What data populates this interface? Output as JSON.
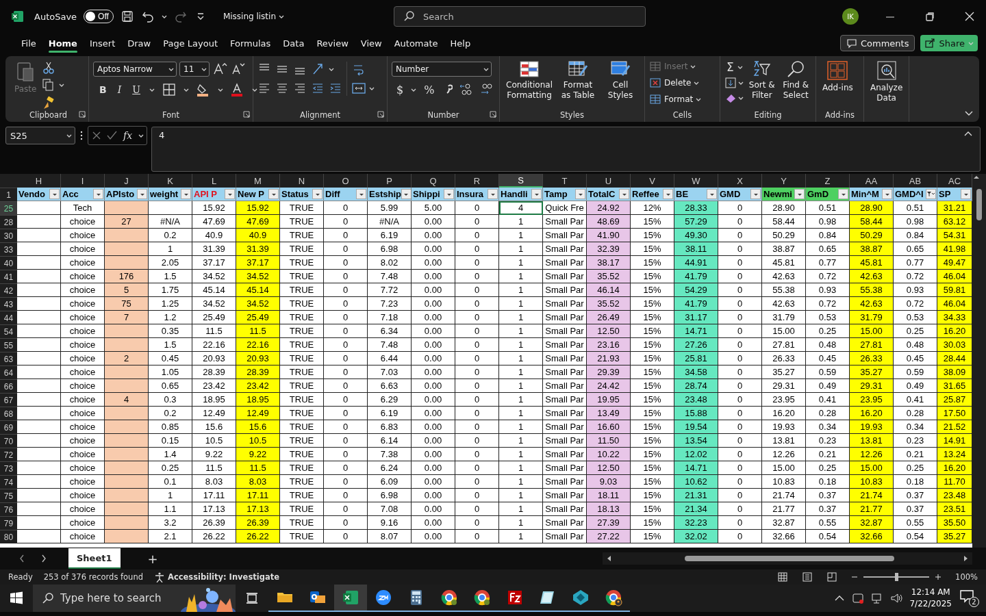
{
  "title_bar": {
    "autosave_label": "AutoSave",
    "autosave": {
      "on": false,
      "label": "Off"
    },
    "file_name": "Missing listin",
    "search": {
      "placeholder": "Search"
    },
    "avatar": "IK"
  },
  "menu_tabs": [
    {
      "label": "File",
      "selected": false
    },
    {
      "label": "Home",
      "selected": true
    },
    {
      "label": "Insert",
      "selected": false
    },
    {
      "label": "Draw",
      "selected": false
    },
    {
      "label": "Page Layout",
      "selected": false
    },
    {
      "label": "Formulas",
      "selected": false
    },
    {
      "label": "Data",
      "selected": false
    },
    {
      "label": "Review",
      "selected": false
    },
    {
      "label": "View",
      "selected": false
    },
    {
      "label": "Automate",
      "selected": false
    },
    {
      "label": "Help",
      "selected": false
    }
  ],
  "comments": "Comments",
  "share": "Share",
  "ribbon": {
    "clipboard": {
      "label": "Clipboard",
      "paste": {
        "label": "Paste",
        "disabled": true
      }
    },
    "font": {
      "label": "Font",
      "font_name": "Aptos Narrow",
      "font_size": "11",
      "bold": "B",
      "italic": "I",
      "underline": "U"
    },
    "alignment": {
      "label": "Alignment"
    },
    "number": {
      "label": "Number",
      "format": "Number",
      "currency": "$",
      "percent": "%"
    },
    "styles": {
      "label": "Styles",
      "buttons": [
        "Conditional Formatting",
        "Format as Table",
        "Cell Styles"
      ]
    },
    "cells": {
      "label": "Cells",
      "buttons": [
        {
          "label": "Insert",
          "disabled": true
        },
        {
          "label": "Delete",
          "disabled": false
        },
        {
          "label": "Format",
          "disabled": false
        }
      ]
    },
    "editing": {
      "label": "Editing",
      "sum": "Σ",
      "buttons": [
        "Sort & Filter",
        "Find & Select"
      ]
    },
    "addins": {
      "label": "Add-ins",
      "button": "Add-ins"
    },
    "analyze": {
      "button": "Analyze Data"
    }
  },
  "formula_bar": {
    "name_box": "S25",
    "fx": "fx",
    "value": "4"
  },
  "sheet": {
    "columns": [
      {
        "letter": "H",
        "header": {
          "label": "Vendo",
          "color": "#9bd3f0",
          "emphasis": false
        },
        "filtered": false,
        "selected": false
      },
      {
        "letter": "I",
        "header": {
          "label": "Acc",
          "color": "#9bd3f0",
          "emphasis": false
        },
        "filtered": false,
        "selected": false
      },
      {
        "letter": "J",
        "header": {
          "label": "APIsto",
          "color": "#9bd3f0",
          "emphasis": false
        },
        "color": "#f8cbad",
        "filtered": false,
        "selected": false
      },
      {
        "letter": "K",
        "header": {
          "label": "weight",
          "color": "#9bd3f0",
          "emphasis": false
        },
        "filtered": false,
        "selected": false
      },
      {
        "letter": "L",
        "header": {
          "label": "API P",
          "color": "#9bd3f0",
          "emphasis": true
        },
        "filtered": false,
        "selected": false
      },
      {
        "letter": "M",
        "header": {
          "label": "New P",
          "color": "#9bd3f0",
          "emphasis": false
        },
        "color": "#ffff00",
        "filtered": false,
        "selected": false
      },
      {
        "letter": "N",
        "header": {
          "label": "Status",
          "color": "#9bd3f0",
          "emphasis": false
        },
        "filtered": false,
        "selected": false
      },
      {
        "letter": "O",
        "header": {
          "label": "Diff",
          "color": "#9bd3f0",
          "emphasis": false
        },
        "filtered": false,
        "selected": false
      },
      {
        "letter": "P",
        "header": {
          "label": "Estship",
          "color": "#9bd3f0",
          "emphasis": false
        },
        "filtered": false,
        "selected": false
      },
      {
        "letter": "Q",
        "header": {
          "label": "Shippi",
          "color": "#9bd3f0",
          "emphasis": false
        },
        "filtered": false,
        "selected": false
      },
      {
        "letter": "R",
        "header": {
          "label": "Insura",
          "color": "#9bd3f0",
          "emphasis": false
        },
        "filtered": false,
        "selected": false
      },
      {
        "letter": "S",
        "header": {
          "label": "Handli",
          "color": "#9bd3f0",
          "emphasis": false
        },
        "filtered": false,
        "selected": true
      },
      {
        "letter": "T",
        "header": {
          "label": "Tamp",
          "color": "#9bd3f0",
          "emphasis": false
        },
        "filtered": false,
        "selected": false
      },
      {
        "letter": "U",
        "header": {
          "label": "TotalC",
          "color": "#9bd3f0",
          "emphasis": false
        },
        "color": "#e8c6e8",
        "filtered": false,
        "selected": false
      },
      {
        "letter": "V",
        "header": {
          "label": "Reffee",
          "color": "#9bd3f0",
          "emphasis": false
        },
        "filtered": false,
        "selected": false
      },
      {
        "letter": "W",
        "header": {
          "label": "BE",
          "color": "#9bd3f0",
          "emphasis": false
        },
        "color": "#66e8c0",
        "filtered": false,
        "selected": false
      },
      {
        "letter": "X",
        "header": {
          "label": "GMD",
          "color": "#9bd3f0",
          "emphasis": false
        },
        "filtered": false,
        "selected": false
      },
      {
        "letter": "Y",
        "header": {
          "label": "Newmi",
          "color": "#4ed061",
          "emphasis": false
        },
        "filtered": false,
        "selected": false
      },
      {
        "letter": "Z",
        "header": {
          "label": "GmD",
          "color": "#4ed061",
          "emphasis": false
        },
        "filtered": false,
        "selected": false
      },
      {
        "letter": "AA",
        "header": {
          "label": "Min^M",
          "color": "#9bd3f0",
          "emphasis": false
        },
        "color": "#ffff00",
        "filtered": false,
        "selected": false
      },
      {
        "letter": "AB",
        "header": {
          "label": "GMD^I",
          "color": "#9bd3f0",
          "emphasis": false
        },
        "filtered": true,
        "selected": false
      },
      {
        "letter": "AC",
        "header": {
          "label": "SP",
          "color": "#9bd3f0",
          "emphasis": false
        },
        "color": "#ffff00",
        "filtered": false,
        "selected": false
      }
    ],
    "header_row": "1",
    "rows": [
      {
        "number": "25",
        "selected": true,
        "cells": [
          null,
          "Tech",
          null,
          null,
          "15.92",
          "15.92",
          "TRUE",
          "0",
          "5.99",
          "5.00",
          "0",
          "4",
          "Quick Fre",
          "24.92",
          "12%",
          "28.33",
          "0",
          "28.90",
          "0.51",
          "28.90",
          "0.51",
          "31.21"
        ]
      },
      {
        "number": "28",
        "selected": false,
        "cells": [
          null,
          "choice",
          "27",
          "#N/A",
          "47.69",
          "47.69",
          "TRUE",
          "0",
          "#N/A",
          "0.00",
          "0",
          "1",
          "Small Par",
          "48.69",
          "15%",
          "57.29",
          "0",
          "58.44",
          "0.98",
          "58.44",
          "0.98",
          "63.12"
        ]
      },
      {
        "number": "30",
        "selected": false,
        "cells": [
          null,
          "choice",
          null,
          "0.2",
          "40.9",
          "40.9",
          "TRUE",
          "0",
          "6.19",
          "0.00",
          "0",
          "1",
          "Small Par",
          "41.90",
          "15%",
          "49.30",
          "0",
          "50.29",
          "0.84",
          "50.29",
          "0.84",
          "54.31"
        ]
      },
      {
        "number": "33",
        "selected": false,
        "cells": [
          null,
          "choice",
          null,
          "1",
          "31.39",
          "31.39",
          "TRUE",
          "0",
          "6.98",
          "0.00",
          "0",
          "1",
          "Small Par",
          "32.39",
          "15%",
          "38.11",
          "0",
          "38.87",
          "0.65",
          "38.87",
          "0.65",
          "41.98"
        ]
      },
      {
        "number": "40",
        "selected": false,
        "cells": [
          null,
          "choice",
          null,
          "2.05",
          "37.17",
          "37.17",
          "TRUE",
          "0",
          "8.02",
          "0.00",
          "0",
          "1",
          "Small Par",
          "38.17",
          "15%",
          "44.91",
          "0",
          "45.81",
          "0.77",
          "45.81",
          "0.77",
          "49.47"
        ]
      },
      {
        "number": "41",
        "selected": false,
        "cells": [
          null,
          "choice",
          "176",
          "1.5",
          "34.52",
          "34.52",
          "TRUE",
          "0",
          "7.48",
          "0.00",
          "0",
          "1",
          "Small Par",
          "35.52",
          "15%",
          "41.79",
          "0",
          "42.63",
          "0.72",
          "42.63",
          "0.72",
          "46.04"
        ]
      },
      {
        "number": "42",
        "selected": false,
        "cells": [
          null,
          "choice",
          "5",
          "1.75",
          "45.14",
          "45.14",
          "TRUE",
          "0",
          "7.72",
          "0.00",
          "0",
          "1",
          "Small Par",
          "46.14",
          "15%",
          "54.29",
          "0",
          "55.38",
          "0.93",
          "55.38",
          "0.93",
          "59.81"
        ]
      },
      {
        "number": "43",
        "selected": false,
        "cells": [
          null,
          "choice",
          "75",
          "1.25",
          "34.52",
          "34.52",
          "TRUE",
          "0",
          "7.23",
          "0.00",
          "0",
          "1",
          "Small Par",
          "35.52",
          "15%",
          "41.79",
          "0",
          "42.63",
          "0.72",
          "42.63",
          "0.72",
          "46.04"
        ]
      },
      {
        "number": "44",
        "selected": false,
        "cells": [
          null,
          "choice",
          "7",
          "1.2",
          "25.49",
          "25.49",
          "TRUE",
          "0",
          "7.18",
          "0.00",
          "0",
          "1",
          "Small Par",
          "26.49",
          "15%",
          "31.17",
          "0",
          "31.79",
          "0.53",
          "31.79",
          "0.53",
          "34.33"
        ]
      },
      {
        "number": "54",
        "selected": false,
        "cells": [
          null,
          "choice",
          null,
          "0.35",
          "11.5",
          "11.5",
          "TRUE",
          "0",
          "6.34",
          "0.00",
          "0",
          "1",
          "Small Par",
          "12.50",
          "15%",
          "14.71",
          "0",
          "15.00",
          "0.25",
          "15.00",
          "0.25",
          "16.20"
        ]
      },
      {
        "number": "55",
        "selected": false,
        "cells": [
          null,
          "choice",
          null,
          "1.5",
          "22.16",
          "22.16",
          "TRUE",
          "0",
          "7.48",
          "0.00",
          "0",
          "1",
          "Small Par",
          "23.16",
          "15%",
          "27.26",
          "0",
          "27.81",
          "0.48",
          "27.81",
          "0.48",
          "30.03"
        ]
      },
      {
        "number": "63",
        "selected": false,
        "cells": [
          null,
          "choice",
          "2",
          "0.45",
          "20.93",
          "20.93",
          "TRUE",
          "0",
          "6.44",
          "0.00",
          "0",
          "1",
          "Small Par",
          "21.93",
          "15%",
          "25.81",
          "0",
          "26.33",
          "0.45",
          "26.33",
          "0.45",
          "28.44"
        ]
      },
      {
        "number": "64",
        "selected": false,
        "cells": [
          null,
          "choice",
          null,
          "1.05",
          "28.39",
          "28.39",
          "TRUE",
          "0",
          "7.03",
          "0.00",
          "0",
          "1",
          "Small Par",
          "29.39",
          "15%",
          "34.58",
          "0",
          "35.27",
          "0.59",
          "35.27",
          "0.59",
          "38.09"
        ]
      },
      {
        "number": "66",
        "selected": false,
        "cells": [
          null,
          "choice",
          null,
          "0.65",
          "23.42",
          "23.42",
          "TRUE",
          "0",
          "6.63",
          "0.00",
          "0",
          "1",
          "Small Par",
          "24.42",
          "15%",
          "28.74",
          "0",
          "29.31",
          "0.49",
          "29.31",
          "0.49",
          "31.65"
        ]
      },
      {
        "number": "67",
        "selected": false,
        "cells": [
          null,
          "choice",
          "4",
          "0.3",
          "18.95",
          "18.95",
          "TRUE",
          "0",
          "6.29",
          "0.00",
          "0",
          "1",
          "Small Par",
          "19.95",
          "15%",
          "23.48",
          "0",
          "23.95",
          "0.41",
          "23.95",
          "0.41",
          "25.87"
        ]
      },
      {
        "number": "68",
        "selected": false,
        "cells": [
          null,
          "choice",
          null,
          "0.2",
          "12.49",
          "12.49",
          "TRUE",
          "0",
          "6.19",
          "0.00",
          "0",
          "1",
          "Small Par",
          "13.49",
          "15%",
          "15.88",
          "0",
          "16.20",
          "0.28",
          "16.20",
          "0.28",
          "17.50"
        ]
      },
      {
        "number": "69",
        "selected": false,
        "cells": [
          null,
          "choice",
          null,
          "0.85",
          "15.6",
          "15.6",
          "TRUE",
          "0",
          "6.83",
          "0.00",
          "0",
          "1",
          "Small Par",
          "16.60",
          "15%",
          "19.54",
          "0",
          "19.93",
          "0.34",
          "19.93",
          "0.34",
          "21.52"
        ]
      },
      {
        "number": "70",
        "selected": false,
        "cells": [
          null,
          "choice",
          null,
          "0.15",
          "10.5",
          "10.5",
          "TRUE",
          "0",
          "6.14",
          "0.00",
          "0",
          "1",
          "Small Par",
          "11.50",
          "15%",
          "13.54",
          "0",
          "13.81",
          "0.23",
          "13.81",
          "0.23",
          "14.91"
        ]
      },
      {
        "number": "72",
        "selected": false,
        "cells": [
          null,
          "choice",
          null,
          "1.4",
          "9.22",
          "9.22",
          "TRUE",
          "0",
          "7.38",
          "0.00",
          "0",
          "1",
          "Small Par",
          "10.22",
          "15%",
          "12.02",
          "0",
          "12.26",
          "0.21",
          "12.26",
          "0.21",
          "13.24"
        ]
      },
      {
        "number": "73",
        "selected": false,
        "cells": [
          null,
          "choice",
          null,
          "0.25",
          "11.5",
          "11.5",
          "TRUE",
          "0",
          "6.24",
          "0.00",
          "0",
          "1",
          "Small Par",
          "12.50",
          "15%",
          "14.71",
          "0",
          "15.00",
          "0.25",
          "15.00",
          "0.25",
          "16.20"
        ]
      },
      {
        "number": "74",
        "selected": false,
        "cells": [
          null,
          "choice",
          null,
          "0.1",
          "8.03",
          "8.03",
          "TRUE",
          "0",
          "6.09",
          "0.00",
          "0",
          "1",
          "Small Par",
          "9.03",
          "15%",
          "10.62",
          "0",
          "10.83",
          "0.18",
          "10.83",
          "0.18",
          "11.70"
        ]
      },
      {
        "number": "75",
        "selected": false,
        "cells": [
          null,
          "choice",
          null,
          "1",
          "17.11",
          "17.11",
          "TRUE",
          "0",
          "6.98",
          "0.00",
          "0",
          "1",
          "Small Par",
          "18.11",
          "15%",
          "21.31",
          "0",
          "21.74",
          "0.37",
          "21.74",
          "0.37",
          "23.48"
        ]
      },
      {
        "number": "76",
        "selected": false,
        "cells": [
          null,
          "choice",
          null,
          "1.1",
          "17.13",
          "17.13",
          "TRUE",
          "0",
          "7.08",
          "0.00",
          "0",
          "1",
          "Small Par",
          "18.13",
          "15%",
          "21.34",
          "0",
          "21.77",
          "0.37",
          "21.77",
          "0.37",
          "23.51"
        ]
      },
      {
        "number": "79",
        "selected": false,
        "cells": [
          null,
          "choice",
          null,
          "3.2",
          "26.39",
          "26.39",
          "TRUE",
          "0",
          "9.16",
          "0.00",
          "0",
          "1",
          "Small Par",
          "27.39",
          "15%",
          "32.23",
          "0",
          "32.87",
          "0.55",
          "32.87",
          "0.55",
          "35.50"
        ]
      },
      {
        "number": "80",
        "selected": false,
        "cells": [
          null,
          "choice",
          null,
          "2.1",
          "26.22",
          "26.22",
          "TRUE",
          "0",
          "8.07",
          "0.00",
          "0",
          "1",
          "Small Par",
          "27.22",
          "15%",
          "32.02",
          "0",
          "32.66",
          "0.54",
          "32.66",
          "0.54",
          "35.27"
        ]
      }
    ]
  },
  "sheet_tabs": [
    {
      "label": "Sheet1",
      "selected": true
    }
  ],
  "add_sheet": "+",
  "status_bar": {
    "ready": "Ready",
    "records": "253 of 376 records found",
    "accessibility": "Accessibility: Investigate",
    "zoom_slider": {
      "level": 0.5
    },
    "zoom": "100%"
  },
  "taskbar": {
    "search_placeholder": "Type here to search",
    "apps": [
      {
        "open": true,
        "selected": false
      },
      {
        "open": true,
        "selected": false
      },
      {
        "open": true,
        "selected": true
      },
      {
        "open": true,
        "selected": false
      },
      {
        "open": true,
        "selected": false
      },
      {
        "open": true,
        "selected": false
      },
      {
        "open": true,
        "selected": false
      },
      {
        "open": true,
        "selected": false
      },
      {
        "open": true,
        "selected": false
      },
      {
        "open": true,
        "selected": false
      },
      {
        "open": true,
        "selected": false
      }
    ],
    "time": "12:14 AM",
    "date": "7/22/2025",
    "notifications": "2"
  }
}
